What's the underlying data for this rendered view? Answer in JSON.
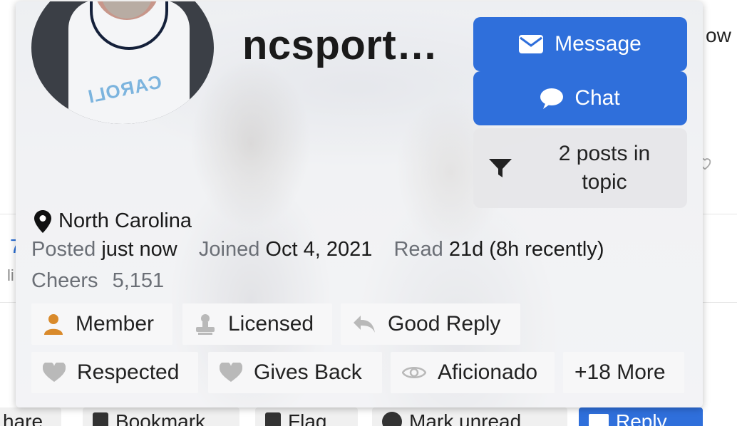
{
  "background_page": {
    "right_text": "ow",
    "left_number": "7",
    "left_fragment": "li",
    "actions": {
      "share": "hare",
      "bookmark": "Bookmark",
      "flag": "Flag",
      "mark_unread": "Mark unread",
      "reply": "Reply"
    }
  },
  "user_card": {
    "username": "ncsport…",
    "avatar_text": "CAROLI",
    "buttons": {
      "message": "Message",
      "chat": "Chat",
      "filter": "2 posts in topic"
    },
    "location": "North Carolina",
    "meta": {
      "posted_label": "Posted",
      "posted_value": "just now",
      "joined_label": "Joined",
      "joined_value": "Oct 4, 2021",
      "read_label": "Read",
      "read_value": "21d (8h recently)",
      "cheers_label": "Cheers",
      "cheers_value": "5,151"
    },
    "badges": [
      {
        "label": "Member",
        "icon": "user-icon"
      },
      {
        "label": "Licensed",
        "icon": "certificate-icon"
      },
      {
        "label": "Good Reply",
        "icon": "reply-icon"
      },
      {
        "label": "Respected",
        "icon": "heart-icon"
      },
      {
        "label": "Gives Back",
        "icon": "heart-icon"
      },
      {
        "label": "Aficionado",
        "icon": "eye-icon"
      },
      {
        "label": "+18 More",
        "icon": ""
      }
    ]
  },
  "colors": {
    "primary": "#2f6fdb",
    "member_icon": "#d98a2b",
    "muted_icon": "#b9b9b9"
  }
}
